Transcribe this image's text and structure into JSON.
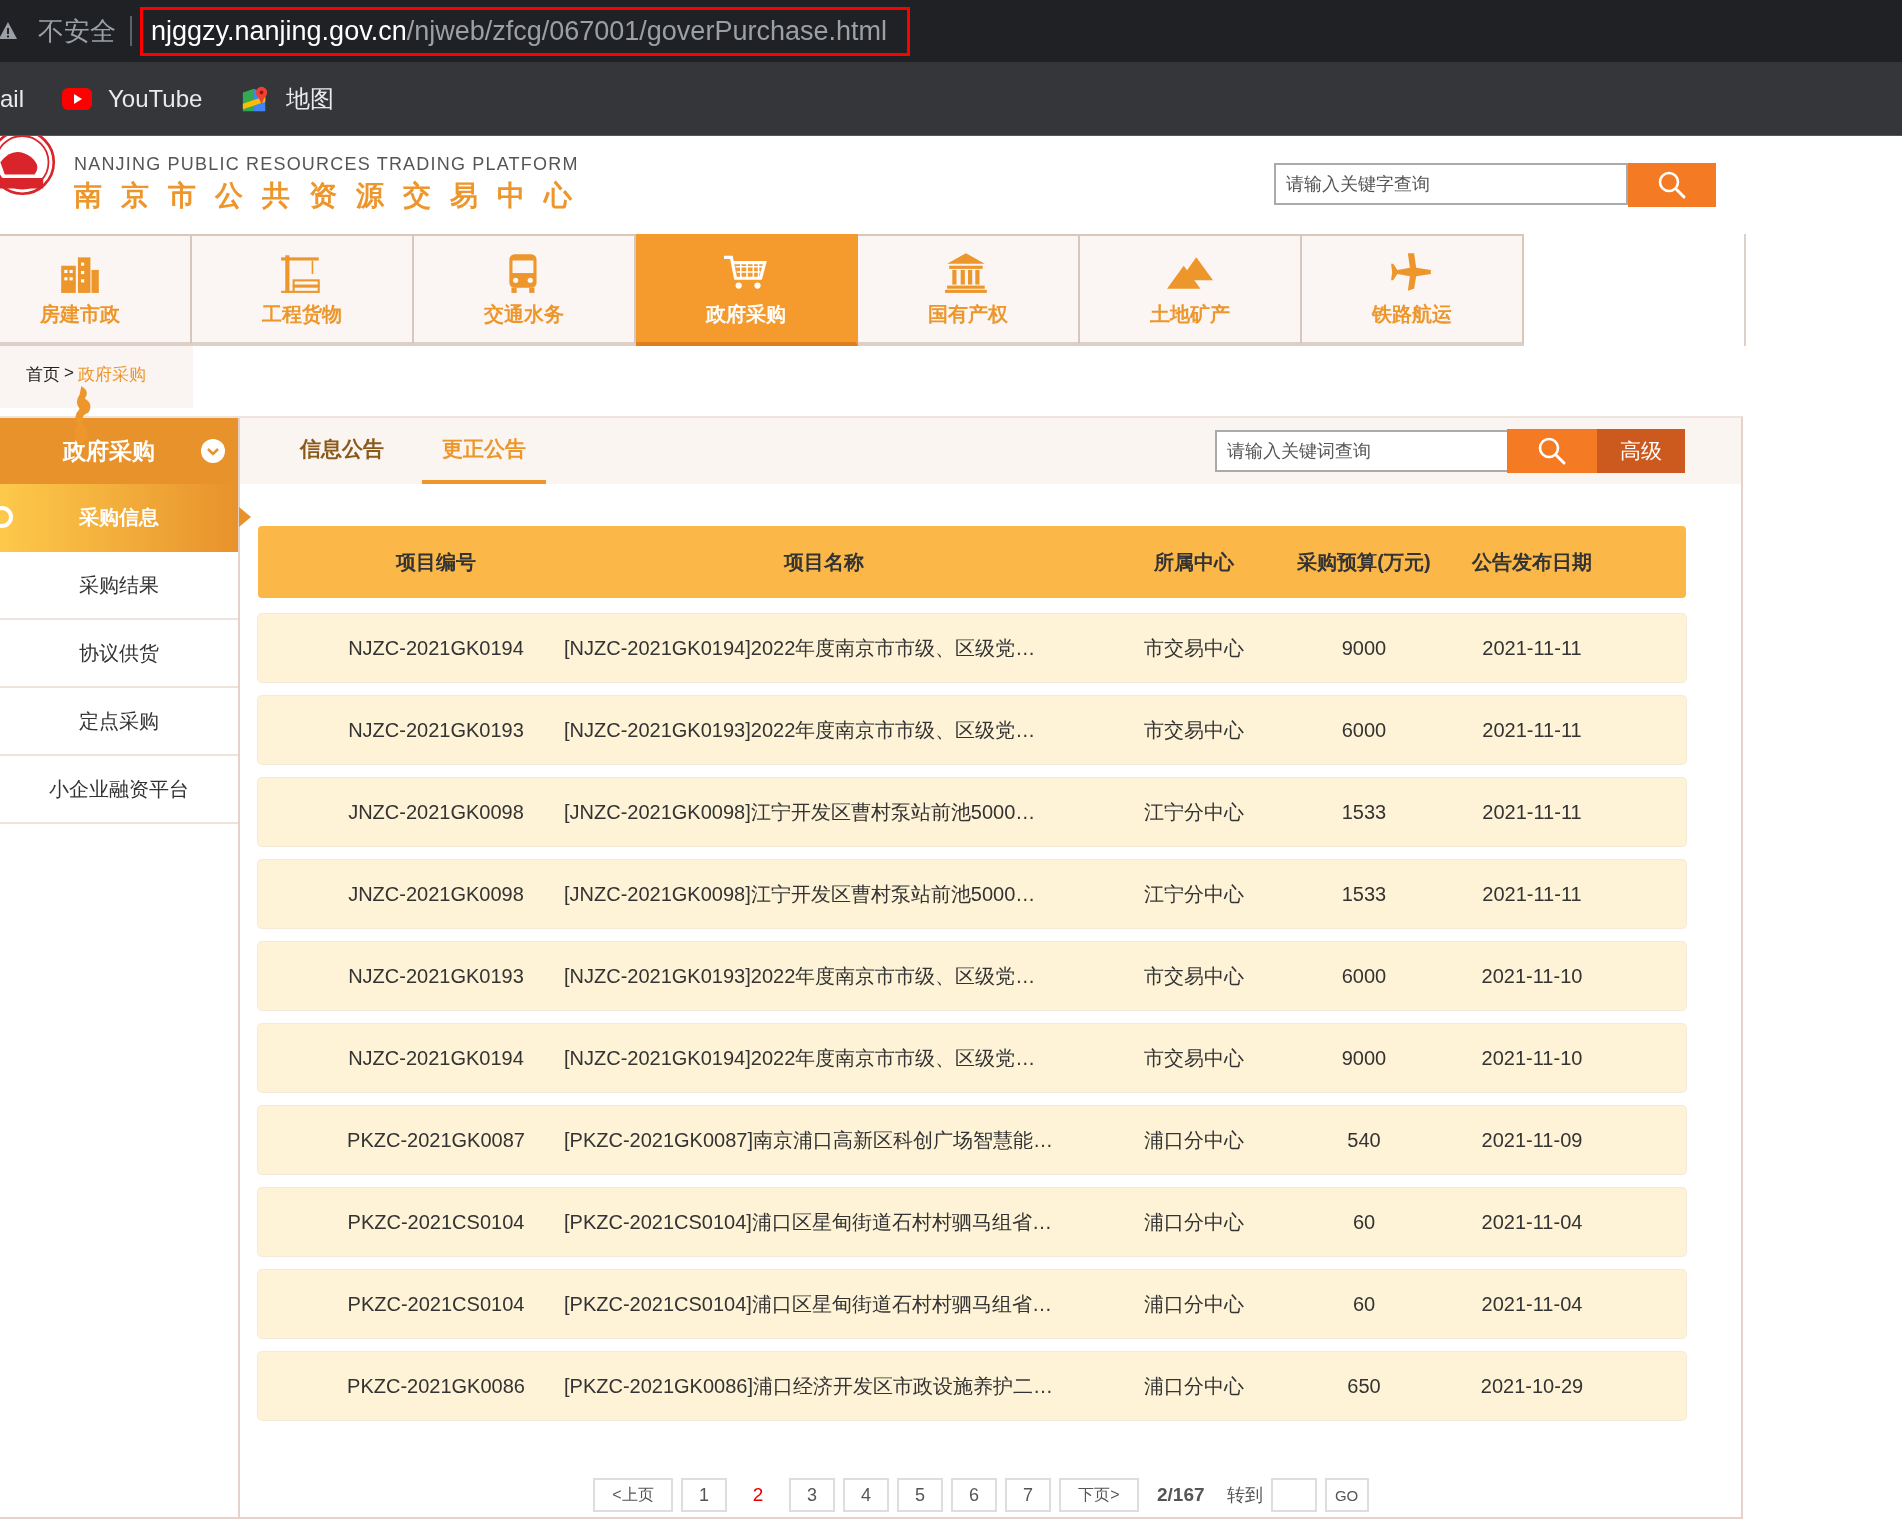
{
  "browser": {
    "security_label": "不安全",
    "url_host": "njggzy.nanjing.gov.cn",
    "url_path": "/njweb/zfcg/067001/goverPurchase.html",
    "url_highlighted": true
  },
  "bookmarks": [
    {
      "label": "ail",
      "kind": "plain"
    },
    {
      "label": "YouTube",
      "kind": "youtube"
    },
    {
      "label": "地图",
      "kind": "maps"
    }
  ],
  "header": {
    "logo_english": "NANJING PUBLIC RESOURCES TRADING PLATFORM",
    "logo_chinese": "南京市公共资源交易中心",
    "search": {
      "placeholder": "请输入关键字查询"
    }
  },
  "nav": [
    {
      "label": "房建市政",
      "kind": "buildings",
      "selected": false
    },
    {
      "label": "工程货物",
      "kind": "crane",
      "selected": false
    },
    {
      "label": "交通水务",
      "kind": "bus",
      "selected": false
    },
    {
      "label": "政府采购",
      "kind": "cart",
      "selected": true
    },
    {
      "label": "国有产权",
      "kind": "bank",
      "selected": false
    },
    {
      "label": "土地矿产",
      "kind": "mountains",
      "selected": false
    },
    {
      "label": "铁路航运",
      "kind": "plane",
      "selected": false
    }
  ],
  "breadcrumb": {
    "items": [
      "首页",
      "政府采购"
    ],
    "separator": ">"
  },
  "sidebar": {
    "title": "政府采购",
    "expanded": true,
    "items": [
      {
        "label": "采购信息",
        "selected": true
      },
      {
        "label": "采购结果",
        "selected": false
      },
      {
        "label": "协议供货",
        "selected": false
      },
      {
        "label": "定点采购",
        "selected": false
      },
      {
        "label": "小企业融资平台",
        "selected": false
      }
    ]
  },
  "tabs": [
    {
      "label": "信息公告",
      "selected": false
    },
    {
      "label": "更正公告",
      "selected": true
    }
  ],
  "list_search": {
    "placeholder": "请输入关键词查询",
    "advanced_label": "高级"
  },
  "table": {
    "columns": [
      "项目编号",
      "项目名称",
      "所属中心",
      "采购预算(万元)",
      "公告发布日期"
    ],
    "rows": [
      [
        "NJZC-2021GK0194",
        "[NJZC-2021GK0194]2022年度南京市市级、区级党…",
        "市交易中心",
        "9000",
        "2021-11-11"
      ],
      [
        "NJZC-2021GK0193",
        "[NJZC-2021GK0193]2022年度南京市市级、区级党…",
        "市交易中心",
        "6000",
        "2021-11-11"
      ],
      [
        "JNZC-2021GK0098",
        "[JNZC-2021GK0098]江宁开发区曹村泵站前池5000…",
        "江宁分中心",
        "1533",
        "2021-11-11"
      ],
      [
        "JNZC-2021GK0098",
        "[JNZC-2021GK0098]江宁开发区曹村泵站前池5000…",
        "江宁分中心",
        "1533",
        "2021-11-11"
      ],
      [
        "NJZC-2021GK0193",
        "[NJZC-2021GK0193]2022年度南京市市级、区级党…",
        "市交易中心",
        "6000",
        "2021-11-10"
      ],
      [
        "NJZC-2021GK0194",
        "[NJZC-2021GK0194]2022年度南京市市级、区级党…",
        "市交易中心",
        "9000",
        "2021-11-10"
      ],
      [
        "PKZC-2021GK0087",
        "[PKZC-2021GK0087]南京浦口高新区科创广场智慧能…",
        "浦口分中心",
        "540",
        "2021-11-09"
      ],
      [
        "PKZC-2021CS0104",
        "[PKZC-2021CS0104]浦口区星甸街道石村村驷马组省…",
        "浦口分中心",
        "60",
        "2021-11-04"
      ],
      [
        "PKZC-2021CS0104",
        "[PKZC-2021CS0104]浦口区星甸街道石村村驷马组省…",
        "浦口分中心",
        "60",
        "2021-11-04"
      ],
      [
        "PKZC-2021GK0086",
        "[PKZC-2021GK0086]浦口经济开发区市政设施养护二…",
        "浦口分中心",
        "650",
        "2021-10-29"
      ]
    ]
  },
  "pagination": {
    "prev": "<上页",
    "pages": [
      {
        "label": "1",
        "selected": false
      },
      {
        "label": "2",
        "selected": true
      },
      {
        "label": "3",
        "selected": false
      },
      {
        "label": "4",
        "selected": false
      },
      {
        "label": "5",
        "selected": false
      },
      {
        "label": "6",
        "selected": false
      },
      {
        "label": "7",
        "selected": false
      }
    ],
    "next": "下页>",
    "summary": "2/167",
    "goto_label": "转到",
    "go": "GO"
  }
}
